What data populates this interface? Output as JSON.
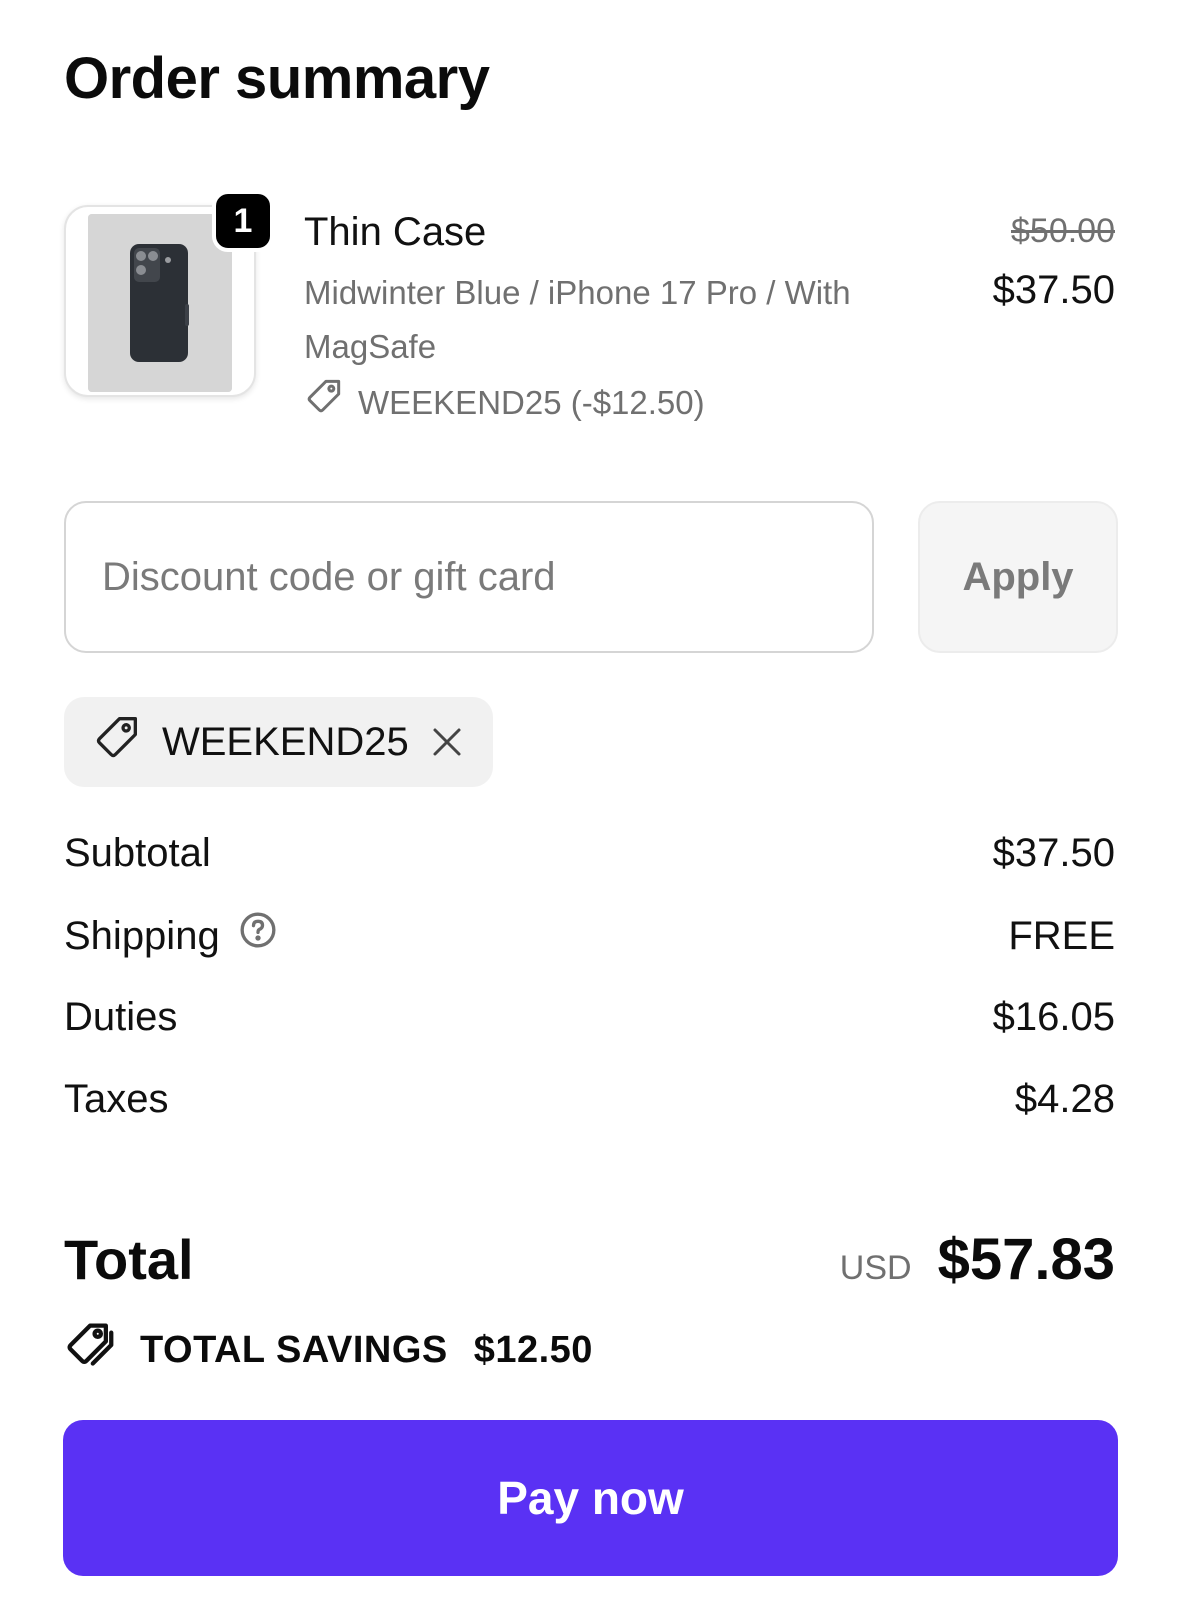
{
  "title": "Order summary",
  "product": {
    "quantity": "1",
    "name": "Thin Case",
    "variant": "Midwinter Blue / iPhone 17 Pro / With MagSafe",
    "discount_line": "WEEKEND25 (-$12.50)",
    "original_price": "$50.00",
    "price": "$37.50"
  },
  "discount": {
    "placeholder": "Discount code or gift card",
    "apply_label": "Apply",
    "applied_code": "WEEKEND25"
  },
  "summary": {
    "subtotal_label": "Subtotal",
    "subtotal_value": "$37.50",
    "shipping_label": "Shipping",
    "shipping_value": "FREE",
    "duties_label": "Duties",
    "duties_value": "$16.05",
    "taxes_label": "Taxes",
    "taxes_value": "$4.28"
  },
  "total": {
    "label": "Total",
    "currency": "USD",
    "amount": "$57.83"
  },
  "savings": {
    "label": "TOTAL SAVINGS",
    "amount": "$12.50"
  },
  "pay_button": "Pay now",
  "colors": {
    "accent": "#5a31f4"
  },
  "icons": [
    "tag-icon",
    "close-icon",
    "help-circle-icon",
    "tags-icon"
  ]
}
